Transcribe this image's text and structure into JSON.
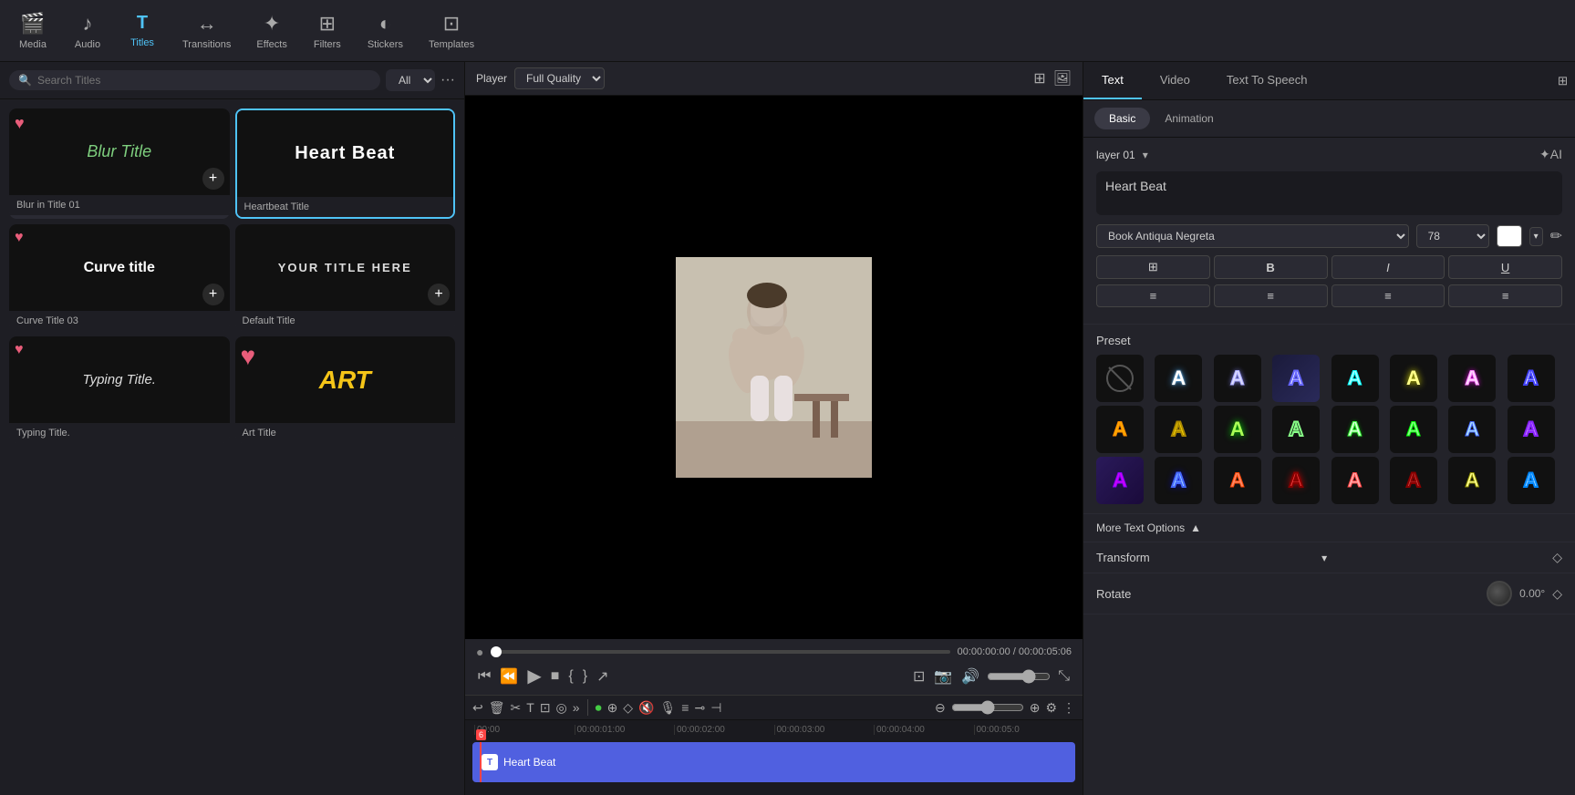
{
  "toolbar": {
    "items": [
      {
        "id": "media",
        "label": "Media",
        "icon": "♪"
      },
      {
        "id": "audio",
        "label": "Audio",
        "icon": "🎵"
      },
      {
        "id": "titles",
        "label": "Titles",
        "icon": "T"
      },
      {
        "id": "transitions",
        "label": "Transitions",
        "icon": "↔"
      },
      {
        "id": "effects",
        "label": "Effects",
        "icon": "✦"
      },
      {
        "id": "filters",
        "label": "Filters",
        "icon": "⊞"
      },
      {
        "id": "stickers",
        "label": "Stickers",
        "icon": "◐"
      },
      {
        "id": "templates",
        "label": "Templates",
        "icon": "⊡"
      }
    ],
    "active": "titles"
  },
  "left_panel": {
    "search_placeholder": "Search Titles",
    "filter": "All",
    "titles": [
      {
        "id": "blur",
        "name": "Blur in Title 01",
        "preview_text": "Blur Title",
        "style": "blur"
      },
      {
        "id": "heartbeat",
        "name": "Heartbeat Title",
        "preview_text": "Heart Beat",
        "style": "heartbeat",
        "selected": true
      },
      {
        "id": "curve",
        "name": "Curve Title 03",
        "preview_text": "Curve title",
        "style": "curve"
      },
      {
        "id": "default",
        "name": "Default Title",
        "preview_text": "YOUR TITLE HERE",
        "style": "default"
      },
      {
        "id": "typing",
        "name": "Typing Title.",
        "preview_text": "Typing Title.",
        "style": "typing"
      },
      {
        "id": "art",
        "name": "Art Title",
        "preview_text": "ART",
        "style": "art"
      }
    ]
  },
  "player": {
    "label": "Player",
    "quality": "Full Quality",
    "time_current": "00:00:00:00",
    "time_total": "00:00:05:06"
  },
  "right_panel": {
    "tabs": [
      "Text",
      "Video",
      "Text To Speech"
    ],
    "active_tab": "Text",
    "sub_tabs": [
      "Basic",
      "Animation"
    ],
    "active_sub_tab": "Basic",
    "layer": "layer 01",
    "text_value": "Heart Beat",
    "font": "Book Antiqua Negreta",
    "font_size": "78",
    "color": "#ffffff",
    "preset_label": "Preset",
    "format_buttons": [
      "B",
      "I",
      "U"
    ],
    "align_buttons": [
      "≡",
      "≡",
      "≡",
      "≡"
    ],
    "more_options_label": "More Text Options",
    "transform_label": "Transform",
    "rotate_label": "Rotate",
    "rotate_value": "0.00°",
    "presets": [
      {
        "style": "no-style"
      },
      {
        "style": "p1"
      },
      {
        "style": "p2"
      },
      {
        "style": "p3"
      },
      {
        "style": "p4"
      },
      {
        "style": "p5"
      },
      {
        "style": "p6"
      },
      {
        "style": "p7"
      },
      {
        "style": "p8"
      },
      {
        "style": "p9"
      },
      {
        "style": "p10"
      },
      {
        "style": "p11"
      },
      {
        "style": "p12"
      },
      {
        "style": "p13"
      },
      {
        "style": "p14"
      },
      {
        "style": "p15"
      },
      {
        "style": "p16"
      },
      {
        "style": "p17"
      },
      {
        "style": "p18"
      },
      {
        "style": "p19"
      },
      {
        "style": "p20"
      },
      {
        "style": "p21"
      },
      {
        "style": "p22"
      },
      {
        "style": "p23"
      },
      {
        "style": "p24"
      }
    ]
  },
  "timeline": {
    "track_label": "Heart Beat",
    "ruler_marks": [
      "00:00",
      "00:00:01:00",
      "00:00:02:00",
      "00:00:03:00",
      "00:00:04:00",
      "00:00:05:0"
    ]
  }
}
